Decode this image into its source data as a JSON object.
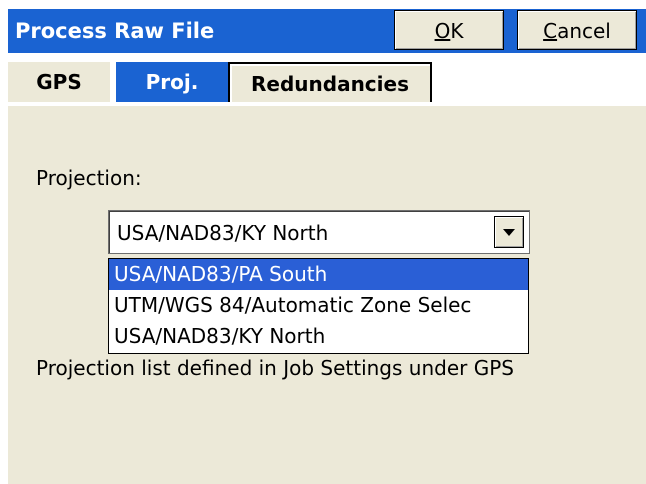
{
  "window": {
    "title": "Process Raw File",
    "ok_label": "OK",
    "ok_underline": "O",
    "ok_rest": "K",
    "cancel_label": "Cancel",
    "cancel_underline": "C",
    "cancel_rest": "ancel"
  },
  "tabs": [
    {
      "label": "GPS",
      "active": false
    },
    {
      "label": "Proj.",
      "active": true
    },
    {
      "label": "Redundancies",
      "active": false
    }
  ],
  "main": {
    "projection_label": "Projection:",
    "projection_selected": "USA/NAD83/KY North",
    "dropdown_options": [
      {
        "label": "USA/NAD83/PA South",
        "highlighted": true
      },
      {
        "label": "UTM/WGS 84/Automatic Zone Selec",
        "highlighted": false
      },
      {
        "label": "USA/NAD83/KY North",
        "highlighted": false
      }
    ],
    "note": "Projection list defined in Job Settings under GPS"
  },
  "colors": {
    "accent": "#1a63d2",
    "highlight": "#2a5fd6",
    "background": "#ece9d8"
  },
  "icons": {
    "combo_arrow": "chevron-down-icon"
  }
}
